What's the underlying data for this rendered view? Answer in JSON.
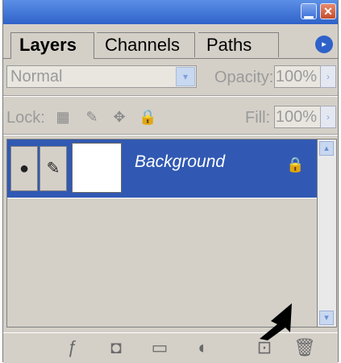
{
  "tabs": {
    "layers": "Layers",
    "channels": "Channels",
    "paths": "Paths"
  },
  "icons": {
    "menu": "▸",
    "minimize": "▁",
    "close": "✕",
    "dropdown": "▾",
    "flyout": "›",
    "lock_transparent": "▦",
    "lock_image": "✎",
    "lock_position": "✥",
    "lock_all": "🔒",
    "eye": "●",
    "brush": "✎",
    "layer_lock": "🔒",
    "scroll_up": "▴",
    "scroll_down": "▾",
    "layer_style": "ƒ",
    "mask": "◘",
    "folder": "▭",
    "adjustment": "◐",
    "new_layer": "⊡",
    "trash": "🗑"
  },
  "blend_mode": {
    "value": "Normal"
  },
  "opacity": {
    "label": "Opacity:",
    "value": "100%"
  },
  "lock": {
    "label": "Lock:"
  },
  "fill": {
    "label": "Fill:",
    "value": "100%"
  },
  "layers": [
    {
      "name": "Background"
    }
  ],
  "colors": {
    "selected_layer": "#3159b3",
    "panel_bg": "#d4d0c8",
    "titlebar": "#2f62c9"
  }
}
